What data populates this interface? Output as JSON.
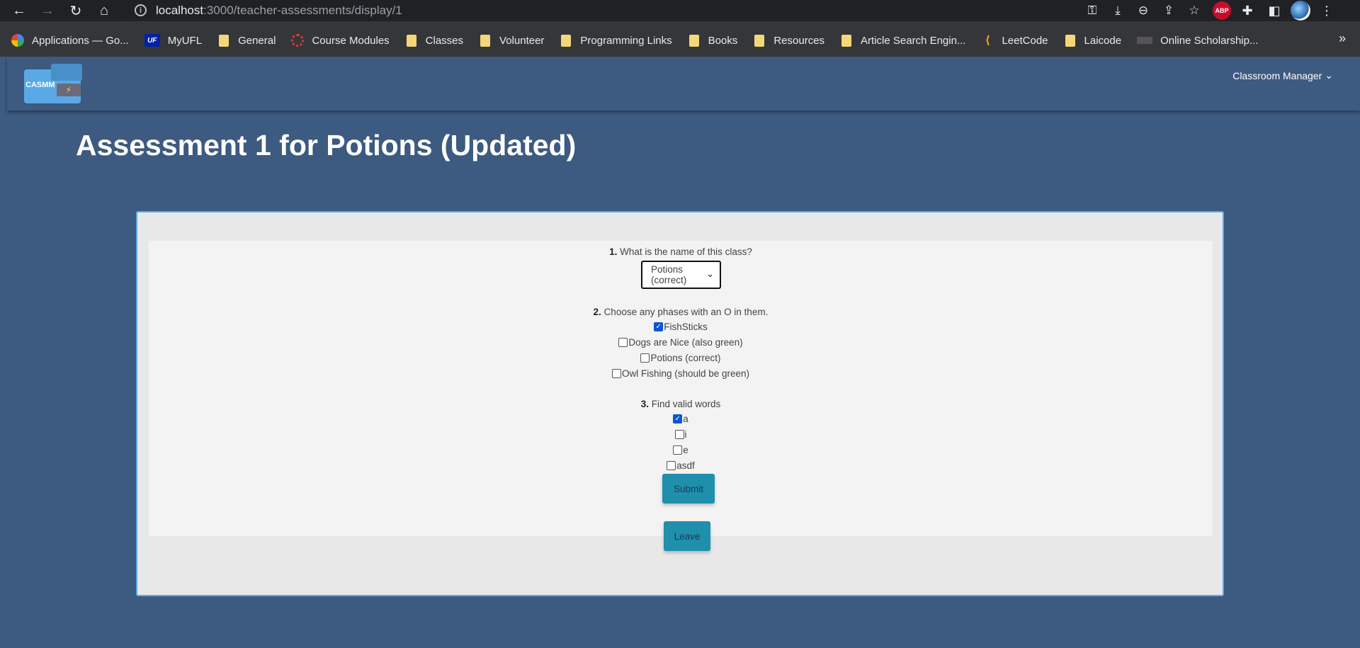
{
  "browser": {
    "url_host": "localhost",
    "url_rest": ":3000/teacher-assessments/display/1",
    "bookmarks": [
      {
        "label": "Applications — Go...",
        "icon": "google-icon"
      },
      {
        "label": "MyUFL",
        "icon": "uf-icon"
      },
      {
        "label": "General",
        "icon": "folder-icon"
      },
      {
        "label": "Course Modules",
        "icon": "canvas-icon"
      },
      {
        "label": "Classes",
        "icon": "folder-icon"
      },
      {
        "label": "Volunteer",
        "icon": "folder-icon"
      },
      {
        "label": "Programming Links",
        "icon": "folder-icon"
      },
      {
        "label": "Books",
        "icon": "folder-icon"
      },
      {
        "label": "Resources",
        "icon": "folder-icon"
      },
      {
        "label": "Article Search Engin...",
        "icon": "folder-icon"
      },
      {
        "label": "LeetCode",
        "icon": "leetcode-icon"
      },
      {
        "label": "Laicode",
        "icon": "folder-icon"
      },
      {
        "label": "Online Scholarship...",
        "icon": "scholarship-icon"
      }
    ],
    "uf_icon_text": "UF",
    "abp_text": "ABP",
    "more_bookmarks": "»"
  },
  "app": {
    "logo_text": "CASMM",
    "menu_label": "Classroom Manager",
    "page_title": "Assessment 1 for Potions (Updated)"
  },
  "assessment": {
    "q1": {
      "number": "1.",
      "text": "What is the name of this class?",
      "selected": "Potions (correct)"
    },
    "q2": {
      "number": "2.",
      "text": "Choose any phases with an O in them.",
      "options": [
        {
          "label": "FishSticks",
          "checked": true
        },
        {
          "label": "Dogs are Nice (also green)",
          "checked": false
        },
        {
          "label": "Potions (correct)",
          "checked": false
        },
        {
          "label": "Owl Fishing (should be green)",
          "checked": false
        }
      ]
    },
    "q3": {
      "number": "3.",
      "text": "Find valid words",
      "options": [
        {
          "label": "a",
          "checked": true
        },
        {
          "label": "i",
          "checked": false
        },
        {
          "label": "e",
          "checked": false
        },
        {
          "label": "asdf",
          "checked": false
        }
      ]
    },
    "submit_label": "Submit",
    "leave_label": "Leave"
  }
}
